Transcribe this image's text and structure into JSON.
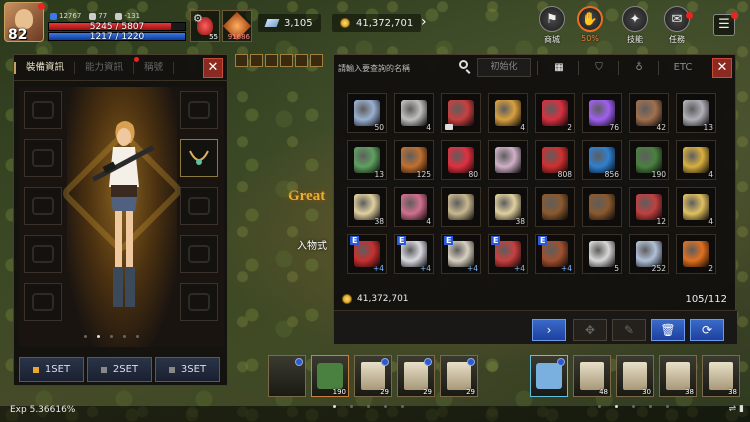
{
  "player": {
    "level": "82",
    "stat1": "12767",
    "stat2": "77",
    "stat3": "-131",
    "hp": "5245 / 5807",
    "mp": "1217 / 1220"
  },
  "quickbar": {
    "potion_count": "55",
    "item_count": "91686"
  },
  "currency": {
    "diamonds": "3,105",
    "gold": "41,372,701"
  },
  "menu": {
    "shop": "商城",
    "percent": "50%",
    "skills": "技能",
    "quests": "任務"
  },
  "world": {
    "text": "Great",
    "subtext": "入物式"
  },
  "equip_panel": {
    "tabs": [
      "裝備資訊",
      "能力資訊",
      "稱號"
    ],
    "sets": [
      "1SET",
      "2SET",
      "3SET"
    ]
  },
  "inventory": {
    "search_placeholder": "請輸入要查詢的名稱",
    "reset": "初始化",
    "etc": "ETC",
    "gold": "41,372,701",
    "count": "105/112",
    "items": [
      {
        "q": "50",
        "c": "#9ab0d0"
      },
      {
        "q": "4",
        "c": "#c0c0c0"
      },
      {
        "q": "",
        "c": "#c84040",
        "lock": true
      },
      {
        "q": "4",
        "c": "#d8a040"
      },
      {
        "q": "2",
        "c": "#d83040"
      },
      {
        "q": "76",
        "c": "#a060f0"
      },
      {
        "q": "42",
        "c": "#a07050"
      },
      {
        "q": "13",
        "c": "#b0b0b8"
      },
      {
        "q": "13",
        "c": "#60a060"
      },
      {
        "q": "125",
        "c": "#c07030"
      },
      {
        "q": "80",
        "c": "#e03040"
      },
      {
        "q": "",
        "c": "#d0b0c8"
      },
      {
        "q": "808",
        "c": "#d03030"
      },
      {
        "q": "856",
        "c": "#3080d0"
      },
      {
        "q": "190",
        "c": "#4a8040"
      },
      {
        "q": "4",
        "c": "#d8b040"
      },
      {
        "q": "38",
        "c": "#e0d0a0"
      },
      {
        "q": "4",
        "c": "#d07090"
      },
      {
        "q": "",
        "c": "#c8b890"
      },
      {
        "q": "38",
        "c": "#e0d0a0"
      },
      {
        "q": "",
        "c": "#8a5a30"
      },
      {
        "q": "",
        "c": "#8a5a30"
      },
      {
        "q": "12",
        "c": "#c04040"
      },
      {
        "q": "4",
        "c": "#e0c060"
      },
      {
        "q": "",
        "c": "#c83030",
        "e": "E",
        "pl": "+4"
      },
      {
        "q": "",
        "c": "#d8d8e0",
        "e": "E",
        "pl": "+4"
      },
      {
        "q": "",
        "c": "#d8d0c0",
        "e": "E",
        "pl": "+4"
      },
      {
        "q": "",
        "c": "#c84040",
        "e": "E",
        "pl": "+4"
      },
      {
        "q": "",
        "c": "#a05030",
        "e": "E",
        "pl": "+4"
      },
      {
        "q": "5",
        "c": "#d8d8d8"
      },
      {
        "q": "252",
        "c": "#b0c0d8"
      },
      {
        "q": "2",
        "c": "#e07020"
      }
    ]
  },
  "hotbar": {
    "left_counts": [
      "",
      "190",
      "29",
      "29",
      "29"
    ],
    "right_counts": [
      "",
      "48",
      "30",
      "38",
      "38"
    ]
  },
  "status": {
    "exp": "Exp  5.36616%"
  }
}
